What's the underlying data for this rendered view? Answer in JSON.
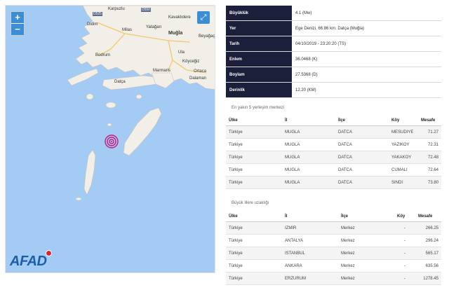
{
  "map": {
    "labels": [
      {
        "name": "karpuzlu",
        "text": "Karpuzlu"
      },
      {
        "name": "kavaklidere",
        "text": "Kavaklıdere"
      },
      {
        "name": "didim",
        "text": "Didim"
      },
      {
        "name": "milas",
        "text": "Milas"
      },
      {
        "name": "yatagan",
        "text": "Yatağan"
      },
      {
        "name": "mugla",
        "text": "Muğla"
      },
      {
        "name": "beyagac",
        "text": "Beyağaç"
      },
      {
        "name": "bodrum",
        "text": "Bodrum"
      },
      {
        "name": "ula",
        "text": "Ula"
      },
      {
        "name": "marmaris",
        "text": "Marmaris"
      },
      {
        "name": "koycegiz",
        "text": "Köyceğiz"
      },
      {
        "name": "ortaca",
        "text": "Ortaca"
      },
      {
        "name": "dalaman",
        "text": "Dalaman"
      },
      {
        "name": "datca",
        "text": "Datça"
      }
    ],
    "road_badges": [
      "D525",
      "D550"
    ],
    "zoom_in": "+",
    "zoom_out": "−",
    "fullscreen_icon": "⤢",
    "logo": "AFAD",
    "epicenter_color": "#c8177d"
  },
  "info": [
    {
      "key": "Büyüklük",
      "value": "4.1 (Mw)"
    },
    {
      "key": "Yer",
      "value": "Ege Denizi, 66.86 km. Datça (Muğla)"
    },
    {
      "key": "Tarih",
      "value": "04/10/2019 - 23:20:20 (TS)"
    },
    {
      "key": "Enlem",
      "value": "36.0468 (K)"
    },
    {
      "key": "Boylam",
      "value": "27.5368 (D)"
    },
    {
      "key": "Derinlik",
      "value": "12.20 (KM)"
    }
  ],
  "nearest": {
    "title": "En yakın 5 yerleşim merkezi",
    "headers": [
      "Ülke",
      "İl",
      "İlçe",
      "Köy",
      "Mesafe"
    ],
    "rows": [
      [
        "Türkiye",
        "MUGLA",
        "DATCA",
        "MESUDIYE",
        "71.27"
      ],
      [
        "Türkiye",
        "MUGLA",
        "DATCA",
        "YAZIKOY",
        "72.31"
      ],
      [
        "Türkiye",
        "MUGLA",
        "DATCA",
        "YAKAKOY",
        "72.48"
      ],
      [
        "Türkiye",
        "MUGLA",
        "DATCA",
        "CUMALI",
        "72.64"
      ],
      [
        "Türkiye",
        "MUGLA",
        "DATCA",
        "SINDI",
        "73.80"
      ]
    ]
  },
  "cities": {
    "title": "Büyük illere uzaklığı",
    "headers": [
      "Ülke",
      "İl",
      "İlçe",
      "Köy",
      "Mesafe"
    ],
    "rows": [
      [
        "Türkiye",
        "IZMIR",
        "Merkez",
        "-",
        "266.25"
      ],
      [
        "Türkiye",
        "ANTALYA",
        "Merkez",
        "-",
        "296.24"
      ],
      [
        "Türkiye",
        "ISTANBUL",
        "Merkez",
        "-",
        "565.17"
      ],
      [
        "Türkiye",
        "ANKARA",
        "Merkez",
        "-",
        "635.56"
      ],
      [
        "Türkiye",
        "ERZURUM",
        "Merkez",
        "-",
        "1278.45"
      ]
    ]
  }
}
